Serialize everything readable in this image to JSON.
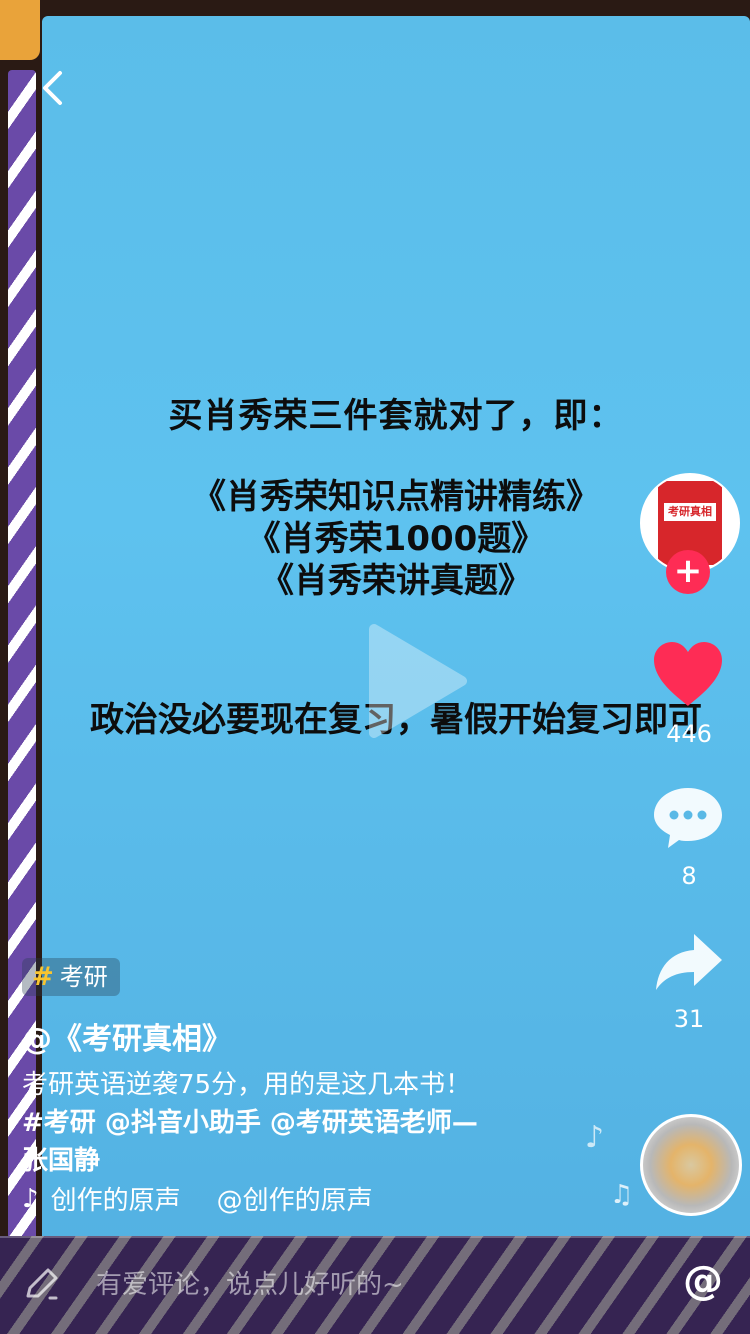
{
  "video": {
    "caption_line1": "买肖秀荣三件套就对了，即：",
    "caption_books": [
      "《肖秀荣知识点精讲精练》",
      "《肖秀荣1000题》",
      "《肖秀荣讲真题》"
    ],
    "caption_line5": "政治没必要现在复习，暑假开始复习即可"
  },
  "rail": {
    "avatar_book_title": "考研真相",
    "likes": "446",
    "comments": "8",
    "shares": "31"
  },
  "info": {
    "hashtag_symbol": "#",
    "hashtag_label": "考研",
    "author": "@《考研真相》",
    "desc_line1": "考研英语逆袭75分，用的是这几本书！",
    "desc_line2": "#考研 @抖音小助手 @考研英语老师—",
    "desc_line3": "张国静",
    "music_left": "创作的原声",
    "music_right": "@创作的原声"
  },
  "comment_bar": {
    "placeholder": "有爱评论，说点儿好听的~",
    "at_symbol": "@"
  },
  "colors": {
    "accent_red": "#fe2c55",
    "video_bg": "#5ec2ef",
    "hashtag_yellow": "#f8c530",
    "frame_purple": "#6a4aa8"
  }
}
